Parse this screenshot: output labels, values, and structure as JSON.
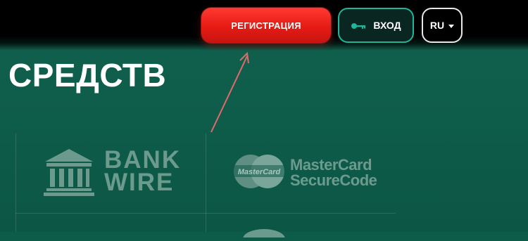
{
  "header": {
    "register_label": "РЕГИСТРАЦИЯ",
    "login_label": "ВХОД",
    "language_label": "RU"
  },
  "main": {
    "heading": "СРЕДСТВ",
    "payment_methods": [
      {
        "line1": "BANK",
        "line2": "WIRE"
      },
      {
        "badge": "MasterCard",
        "line1": "MasterCard",
        "line2": "SecureCode"
      }
    ]
  },
  "colors": {
    "background": "#0d5c4a",
    "register": "#e51b14",
    "login_border": "#1fb59a",
    "annotation_arrow": "#e06a6a",
    "logo_tint": "#6c9a8d"
  },
  "icons": [
    "key-icon",
    "chevron-down-icon",
    "bank-icon",
    "mastercard-icon"
  ]
}
